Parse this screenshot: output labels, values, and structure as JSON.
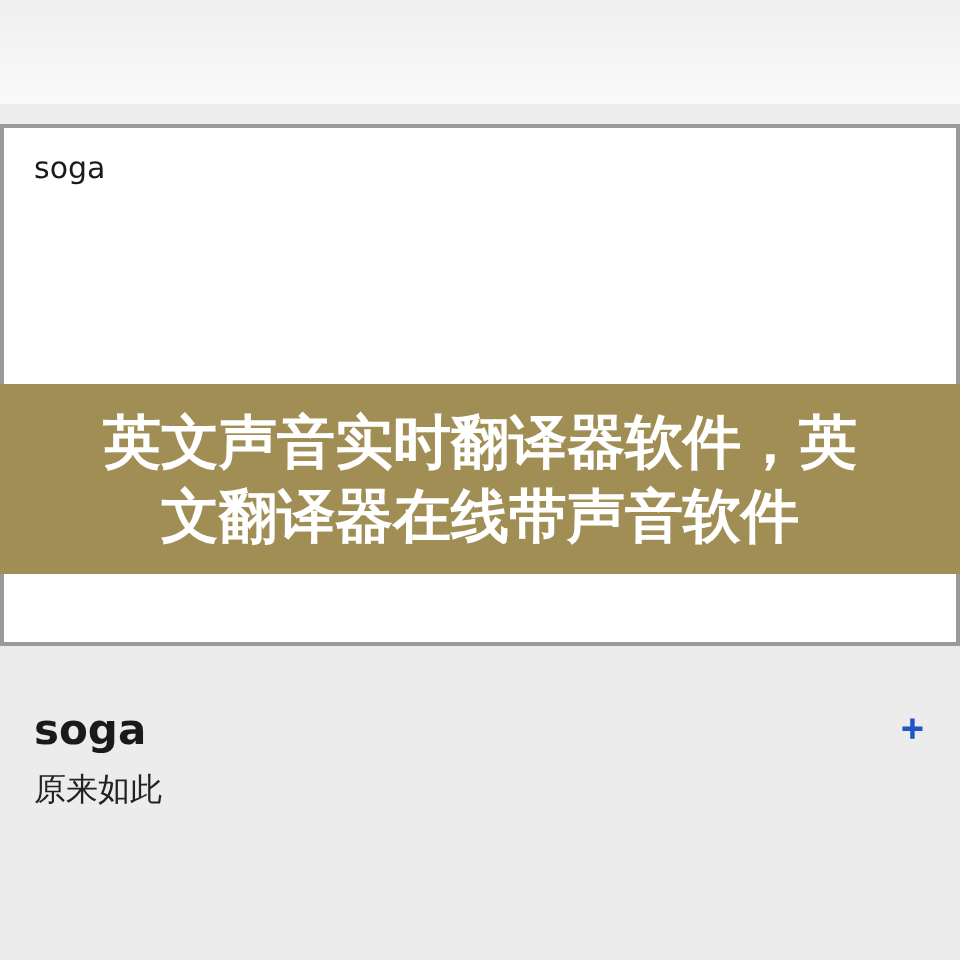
{
  "input": {
    "value": "soga"
  },
  "banner": {
    "title": "英文声音实时翻译器软件，英文翻译器在线带声音软件"
  },
  "result": {
    "word": "soga",
    "meaning": "原来如此",
    "add_button": "+"
  }
}
